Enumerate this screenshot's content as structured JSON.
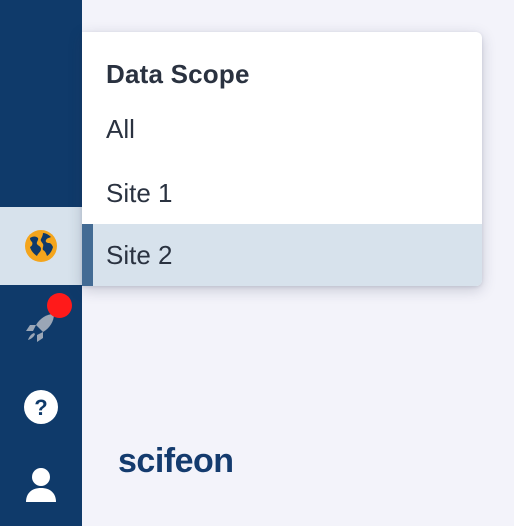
{
  "sidebar": {
    "items": [
      {
        "icon": "globe-icon",
        "active": true
      },
      {
        "icon": "rocket-icon",
        "badge_color": "#ff1a1a"
      },
      {
        "icon": "help-icon"
      },
      {
        "icon": "user-icon"
      }
    ]
  },
  "dropdown": {
    "title": "Data Scope",
    "options": [
      "All",
      "Site 1",
      "Site 2"
    ],
    "selected": "Site 2"
  },
  "logo": {
    "text": "scifeon"
  },
  "colors": {
    "sidebar_bg": "#0f3a6a",
    "selected_bg": "#d7e2ec",
    "selected_marker": "#436b94",
    "globe_accent": "#f4a51c",
    "badge": "#ff1a1a",
    "background": "#f3f3fa"
  }
}
